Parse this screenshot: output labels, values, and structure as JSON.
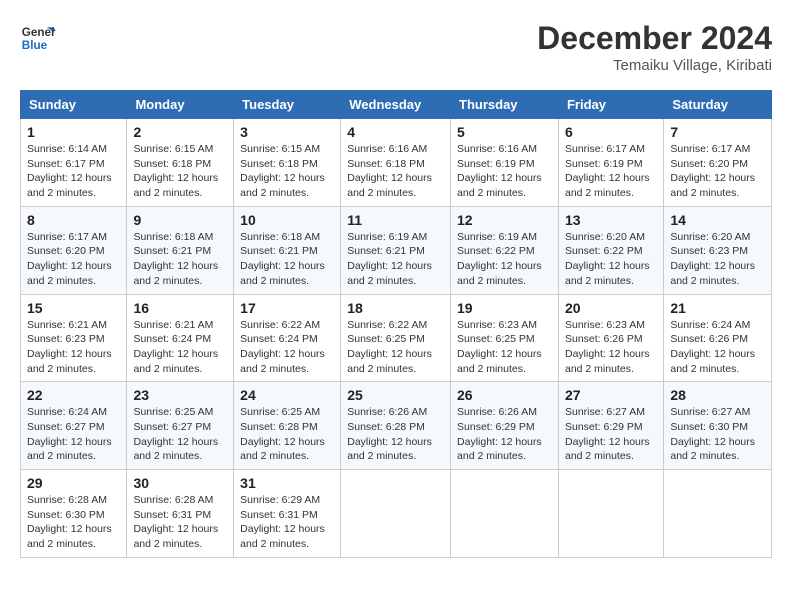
{
  "logo": {
    "line1": "General",
    "line2": "Blue"
  },
  "title": "December 2024",
  "location": "Temaiku Village, Kiribati",
  "headers": [
    "Sunday",
    "Monday",
    "Tuesday",
    "Wednesday",
    "Thursday",
    "Friday",
    "Saturday"
  ],
  "weeks": [
    [
      {
        "day": "1",
        "sunrise": "6:14 AM",
        "sunset": "6:17 PM",
        "daylight": "12 hours and 2 minutes."
      },
      {
        "day": "2",
        "sunrise": "6:15 AM",
        "sunset": "6:18 PM",
        "daylight": "12 hours and 2 minutes."
      },
      {
        "day": "3",
        "sunrise": "6:15 AM",
        "sunset": "6:18 PM",
        "daylight": "12 hours and 2 minutes."
      },
      {
        "day": "4",
        "sunrise": "6:16 AM",
        "sunset": "6:18 PM",
        "daylight": "12 hours and 2 minutes."
      },
      {
        "day": "5",
        "sunrise": "6:16 AM",
        "sunset": "6:19 PM",
        "daylight": "12 hours and 2 minutes."
      },
      {
        "day": "6",
        "sunrise": "6:17 AM",
        "sunset": "6:19 PM",
        "daylight": "12 hours and 2 minutes."
      },
      {
        "day": "7",
        "sunrise": "6:17 AM",
        "sunset": "6:20 PM",
        "daylight": "12 hours and 2 minutes."
      }
    ],
    [
      {
        "day": "8",
        "sunrise": "6:17 AM",
        "sunset": "6:20 PM",
        "daylight": "12 hours and 2 minutes."
      },
      {
        "day": "9",
        "sunrise": "6:18 AM",
        "sunset": "6:21 PM",
        "daylight": "12 hours and 2 minutes."
      },
      {
        "day": "10",
        "sunrise": "6:18 AM",
        "sunset": "6:21 PM",
        "daylight": "12 hours and 2 minutes."
      },
      {
        "day": "11",
        "sunrise": "6:19 AM",
        "sunset": "6:21 PM",
        "daylight": "12 hours and 2 minutes."
      },
      {
        "day": "12",
        "sunrise": "6:19 AM",
        "sunset": "6:22 PM",
        "daylight": "12 hours and 2 minutes."
      },
      {
        "day": "13",
        "sunrise": "6:20 AM",
        "sunset": "6:22 PM",
        "daylight": "12 hours and 2 minutes."
      },
      {
        "day": "14",
        "sunrise": "6:20 AM",
        "sunset": "6:23 PM",
        "daylight": "12 hours and 2 minutes."
      }
    ],
    [
      {
        "day": "15",
        "sunrise": "6:21 AM",
        "sunset": "6:23 PM",
        "daylight": "12 hours and 2 minutes."
      },
      {
        "day": "16",
        "sunrise": "6:21 AM",
        "sunset": "6:24 PM",
        "daylight": "12 hours and 2 minutes."
      },
      {
        "day": "17",
        "sunrise": "6:22 AM",
        "sunset": "6:24 PM",
        "daylight": "12 hours and 2 minutes."
      },
      {
        "day": "18",
        "sunrise": "6:22 AM",
        "sunset": "6:25 PM",
        "daylight": "12 hours and 2 minutes."
      },
      {
        "day": "19",
        "sunrise": "6:23 AM",
        "sunset": "6:25 PM",
        "daylight": "12 hours and 2 minutes."
      },
      {
        "day": "20",
        "sunrise": "6:23 AM",
        "sunset": "6:26 PM",
        "daylight": "12 hours and 2 minutes."
      },
      {
        "day": "21",
        "sunrise": "6:24 AM",
        "sunset": "6:26 PM",
        "daylight": "12 hours and 2 minutes."
      }
    ],
    [
      {
        "day": "22",
        "sunrise": "6:24 AM",
        "sunset": "6:27 PM",
        "daylight": "12 hours and 2 minutes."
      },
      {
        "day": "23",
        "sunrise": "6:25 AM",
        "sunset": "6:27 PM",
        "daylight": "12 hours and 2 minutes."
      },
      {
        "day": "24",
        "sunrise": "6:25 AM",
        "sunset": "6:28 PM",
        "daylight": "12 hours and 2 minutes."
      },
      {
        "day": "25",
        "sunrise": "6:26 AM",
        "sunset": "6:28 PM",
        "daylight": "12 hours and 2 minutes."
      },
      {
        "day": "26",
        "sunrise": "6:26 AM",
        "sunset": "6:29 PM",
        "daylight": "12 hours and 2 minutes."
      },
      {
        "day": "27",
        "sunrise": "6:27 AM",
        "sunset": "6:29 PM",
        "daylight": "12 hours and 2 minutes."
      },
      {
        "day": "28",
        "sunrise": "6:27 AM",
        "sunset": "6:30 PM",
        "daylight": "12 hours and 2 minutes."
      }
    ],
    [
      {
        "day": "29",
        "sunrise": "6:28 AM",
        "sunset": "6:30 PM",
        "daylight": "12 hours and 2 minutes."
      },
      {
        "day": "30",
        "sunrise": "6:28 AM",
        "sunset": "6:31 PM",
        "daylight": "12 hours and 2 minutes."
      },
      {
        "day": "31",
        "sunrise": "6:29 AM",
        "sunset": "6:31 PM",
        "daylight": "12 hours and 2 minutes."
      },
      null,
      null,
      null,
      null
    ]
  ]
}
